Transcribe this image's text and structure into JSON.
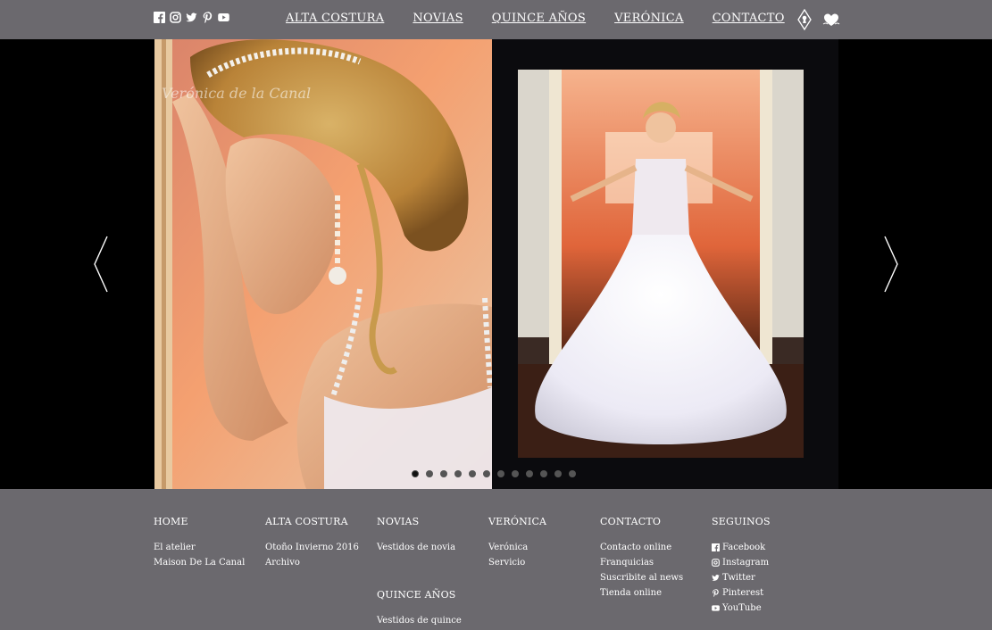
{
  "header": {
    "social_icons": [
      "facebook-icon",
      "instagram-icon",
      "twitter-icon",
      "pinterest-icon",
      "youtube-icon"
    ],
    "nav": [
      "ALTA COSTURA",
      "NOVIAS",
      "QUINCE AÑOS",
      "VERÓNICA",
      "CONTACTO"
    ],
    "right_icons": [
      "keyhole-icon",
      "heart-icon"
    ]
  },
  "slider": {
    "watermark": "Verónica de la Canal",
    "dot_count": 12,
    "active_dot": 1,
    "icons": [
      "chevron-left-icon",
      "chevron-right-icon"
    ]
  },
  "footer": {
    "home": {
      "heading": "HOME",
      "items": [
        "El atelier",
        "Maison De La Canal"
      ]
    },
    "alta_costura": {
      "heading": "ALTA COSTURA",
      "items": [
        "Otoño Invierno 2016",
        "Archivo"
      ]
    },
    "novias": {
      "heading": "NOVIAS",
      "items": [
        "Vestidos de novia"
      ]
    },
    "quince": {
      "heading": "QUINCE AÑOS",
      "items": [
        "Vestidos de quince"
      ]
    },
    "veronica": {
      "heading": "VERÓNICA",
      "items": [
        "Verónica",
        "Servicio"
      ]
    },
    "contacto": {
      "heading": "CONTACTO",
      "items": [
        "Contacto online",
        "Franquicias",
        "Suscribite al news",
        "Tienda online"
      ]
    },
    "seguinos": {
      "heading": "SEGUINOS",
      "items": [
        "Facebook",
        "Instagram",
        "Twitter",
        "Pinterest",
        "YouTube"
      ]
    }
  },
  "colors": {
    "bar": "#6b696e",
    "background": "#000000",
    "text": "#ffffff"
  }
}
